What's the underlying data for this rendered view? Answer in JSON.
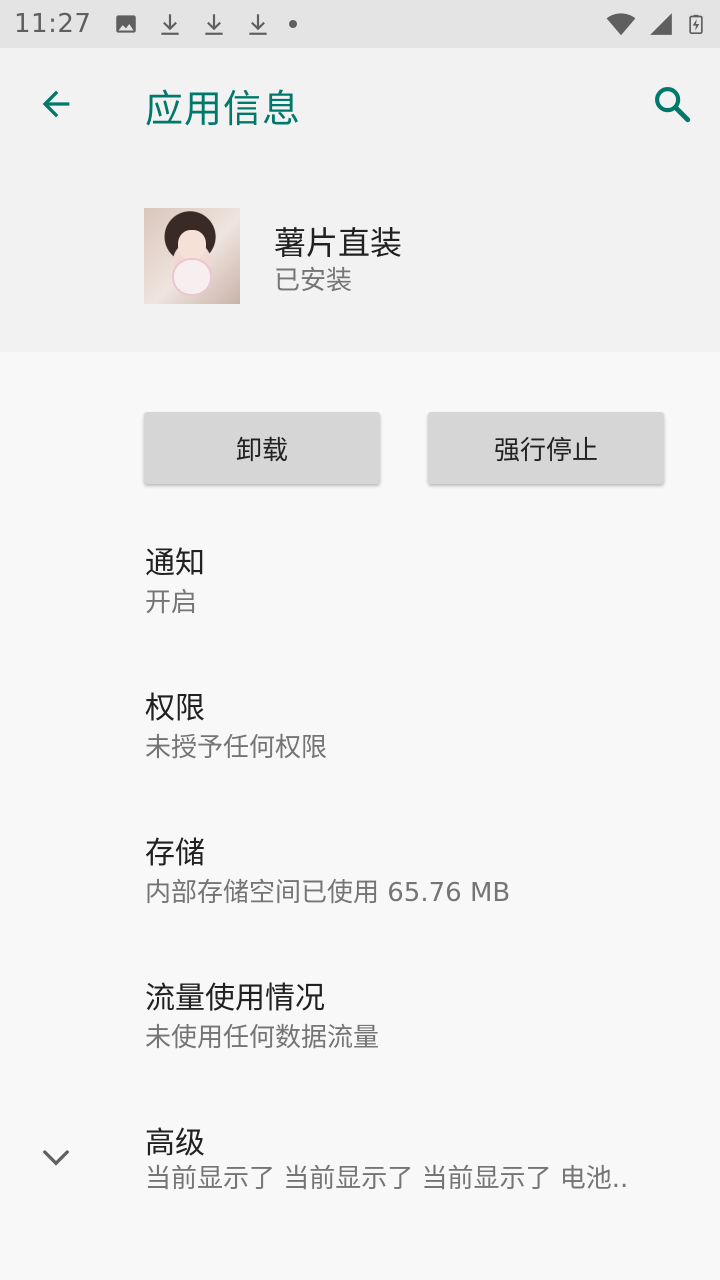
{
  "status_bar": {
    "time": "11:27",
    "left_icons": [
      "image-icon",
      "download-icon",
      "download-icon",
      "download-icon",
      "dot-icon"
    ],
    "right_icons": [
      "wifi-icon",
      "signal-icon",
      "battery-charging-icon"
    ]
  },
  "toolbar": {
    "title": "应用信息",
    "back_icon": "arrow-back-icon",
    "search_icon": "search-icon"
  },
  "app": {
    "name": "薯片直装",
    "status": "已安装"
  },
  "buttons": {
    "uninstall": "卸载",
    "force_stop": "强行停止"
  },
  "settings": [
    {
      "title": "通知",
      "summary": "开启"
    },
    {
      "title": "权限",
      "summary": "未授予任何权限"
    },
    {
      "title": "存储",
      "summary": "内部存储空间已使用 65.76 MB"
    },
    {
      "title": "流量使用情况",
      "summary": "未使用任何数据流量"
    },
    {
      "title": "高级",
      "summary": "当前显示了 当前显示了 当前显示了 电池.."
    }
  ],
  "colors": {
    "accent": "#00796b",
    "status_bar": "#e4e4e4",
    "header_bg": "#f2f2f2",
    "page_bg": "#f8f8f8",
    "button_bg": "#d6d6d6"
  }
}
